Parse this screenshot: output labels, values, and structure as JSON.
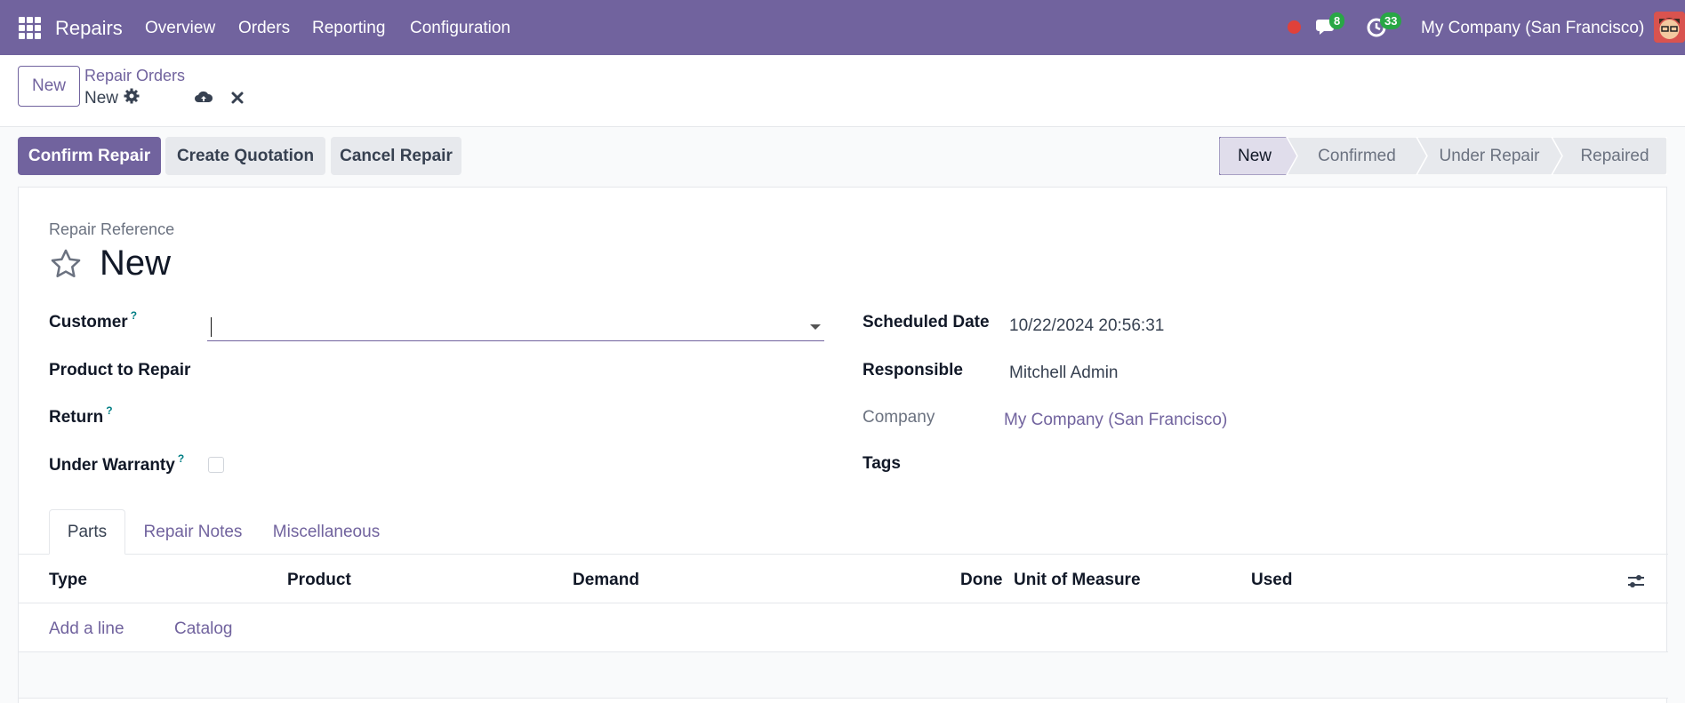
{
  "navbar": {
    "app_name": "Repairs",
    "menu": [
      "Overview",
      "Orders",
      "Reporting",
      "Configuration"
    ],
    "messages_count": "8",
    "activities_count": "33",
    "company": "My Company (San Francisco)"
  },
  "control_panel": {
    "new_button": "New",
    "breadcrumb_parent": "Repair Orders",
    "breadcrumb_current": "New"
  },
  "actions": {
    "confirm": "Confirm Repair",
    "create_quotation": "Create Quotation",
    "cancel": "Cancel Repair"
  },
  "stages": [
    "New",
    "Confirmed",
    "Under Repair",
    "Repaired"
  ],
  "form": {
    "ref_label": "Repair Reference",
    "title": "New",
    "customer_label": "Customer",
    "product_label": "Product to Repair",
    "return_label": "Return",
    "warranty_label": "Under Warranty",
    "help_mark": "?",
    "scheduled_label": "Scheduled Date",
    "scheduled_value": "10/22/2024 20:56:31",
    "responsible_label": "Responsible",
    "responsible_value": "Mitchell Admin",
    "company_label": "Company",
    "company_value": "My Company (San Francisco)",
    "tags_label": "Tags"
  },
  "tabs": [
    "Parts",
    "Repair Notes",
    "Miscellaneous"
  ],
  "table": {
    "columns": [
      "Type",
      "Product",
      "Demand",
      "Done",
      "Unit of Measure",
      "Used"
    ],
    "add_line": "Add a line",
    "catalog": "Catalog"
  },
  "colors": {
    "brand": "#71639e",
    "badge": "#28a745",
    "record": "#e0413a"
  }
}
